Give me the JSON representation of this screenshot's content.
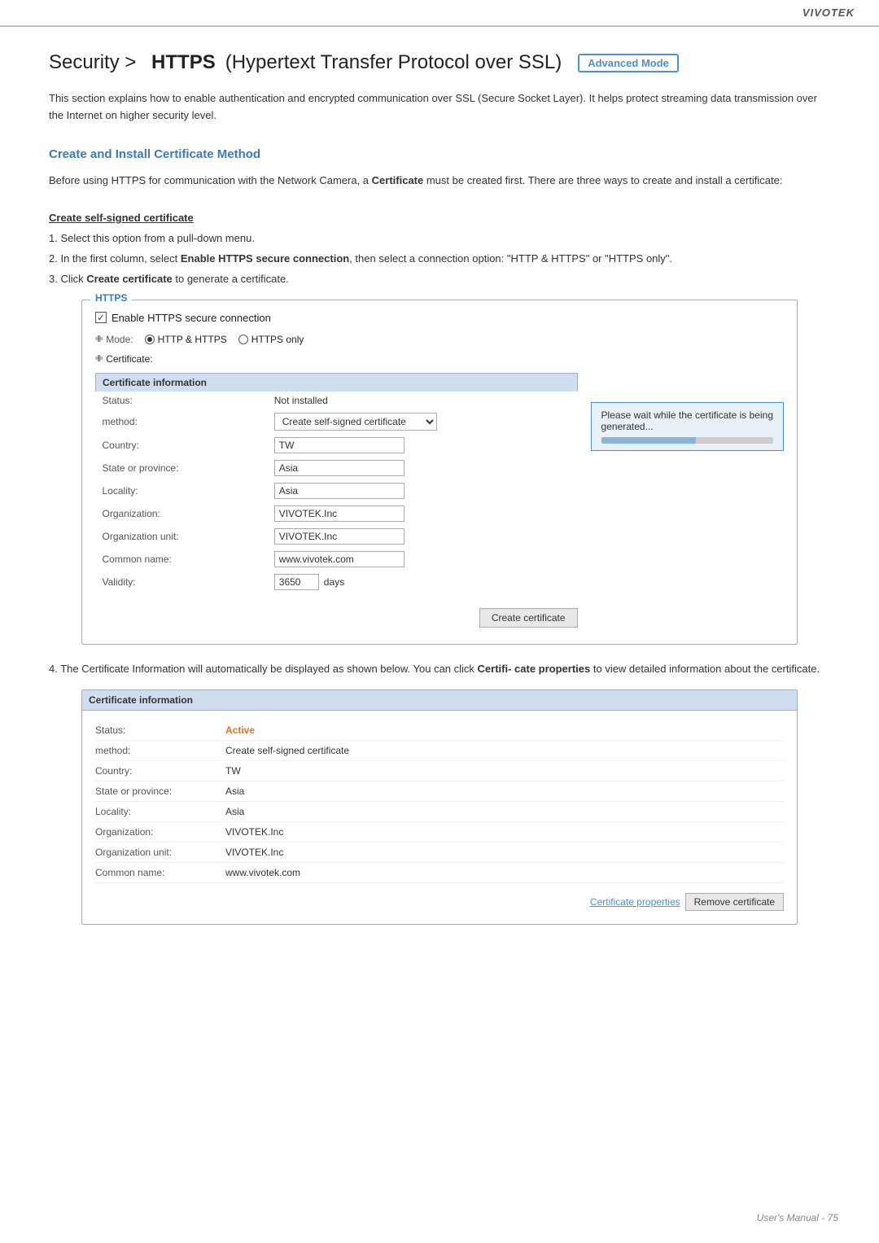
{
  "brand": "VIVOTEK",
  "header": {
    "title_prefix": "Security >  HTTPS",
    "title_middle": "(Hypertext Transfer Protocol over SSL)",
    "advanced_mode": "Advanced Mode"
  },
  "intro": {
    "text": "This section explains how to enable authentication and encrypted communication over SSL (Secure Socket Layer). It helps protect streaming data transmission over the Internet on higher security level."
  },
  "section": {
    "heading": "Create and Install Certificate Method",
    "before_text": "Before using HTTPS for communication with the Network Camera, a Certificate must be created first. There are three ways to create and install a certificate:",
    "create_self_signed": {
      "subheading": "Create self-signed certificate",
      "steps": [
        "Select this option from a pull-down menu.",
        "In the first column, select Enable HTTPS secure connection, then select a connection option: \"HTTP & HTTPS\" or \"HTTPS only\".",
        "Click Create certificate to generate a certificate."
      ]
    }
  },
  "https_box": {
    "title": "HTTPS",
    "enable_label": "Enable HTTPS secure connection",
    "mode_label": "Mode:",
    "mode_options": [
      {
        "label": "HTTP & HTTPS",
        "selected": true
      },
      {
        "label": "HTTPS only",
        "selected": false
      }
    ],
    "cert_label": "Certificate:",
    "cert_info_box": {
      "line1": "Please wait while the certificate is being",
      "line2": "generated..."
    },
    "table_header": "Certificate information",
    "rows": [
      {
        "label": "Status:",
        "value": "Not installed",
        "type": "text"
      },
      {
        "label": "method:",
        "value": "Create self-signed certificate",
        "type": "select"
      },
      {
        "label": "Country:",
        "value": "TW",
        "type": "input"
      },
      {
        "label": "State or province:",
        "value": "Asia",
        "type": "input"
      },
      {
        "label": "Locality:",
        "value": "Asia",
        "type": "input"
      },
      {
        "label": "Organization:",
        "value": "VIVOTEK.Inc",
        "type": "input"
      },
      {
        "label": "Organization unit:",
        "value": "VIVOTEK.Inc",
        "type": "input"
      },
      {
        "label": "Common name:",
        "value": "www.vivotek.com",
        "type": "input"
      },
      {
        "label": "Validity:",
        "value": "3650",
        "unit": "days",
        "type": "validity"
      }
    ],
    "create_button": "Create certificate"
  },
  "step4": {
    "text_before": "4. The Certificate Information will automatically be displayed as shown below. You can click Certifi- cate properties to view detailed information about the certificate."
  },
  "cert_info_panel": {
    "header": "Certificate information",
    "rows": [
      {
        "label": "Status:",
        "value": "Active",
        "type": "active"
      },
      {
        "label": "method:",
        "value": "Create self-signed certificate",
        "type": "text"
      },
      {
        "label": "Country:",
        "value": "TW",
        "type": "text"
      },
      {
        "label": "State or province:",
        "value": "Asia",
        "type": "text"
      },
      {
        "label": "Locality:",
        "value": "Asia",
        "type": "text"
      },
      {
        "label": "Organization:",
        "value": "VIVOTEK.Inc",
        "type": "text"
      },
      {
        "label": "Organization unit:",
        "value": "VIVOTEK.Inc",
        "type": "text"
      },
      {
        "label": "Common name:",
        "value": "www.vivotek.com",
        "type": "text"
      }
    ],
    "cert_properties_link": "Certificate properties",
    "remove_button": "Remove certificate"
  },
  "footer": {
    "text": "User's Manual - 75"
  }
}
